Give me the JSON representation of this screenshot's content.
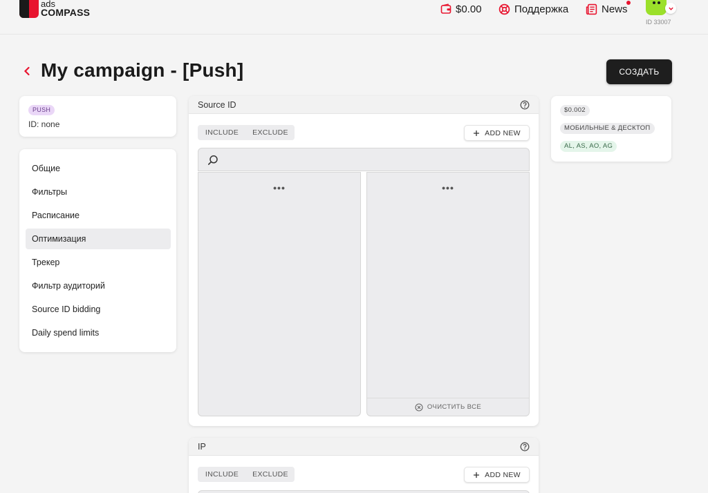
{
  "header": {
    "logo_top": "ads",
    "logo_bottom": "COMPASS",
    "balance": "$0.00",
    "support_label": "Поддержка",
    "news_label": "News",
    "user_id": "ID 33007"
  },
  "page": {
    "title": "My campaign - [Push]",
    "create_label": "СОЗДАТЬ"
  },
  "campaign": {
    "type_badge": "PUSH",
    "id_text": "ID: none"
  },
  "sidebar": {
    "items": [
      {
        "label": "Общие",
        "active": false
      },
      {
        "label": "Фильтры",
        "active": false
      },
      {
        "label": "Расписание",
        "active": false
      },
      {
        "label": "Оптимизация",
        "active": true
      },
      {
        "label": "Трекер",
        "active": false
      },
      {
        "label": "Фильтр аудиторий",
        "active": false
      },
      {
        "label": "Source ID bidding",
        "active": false
      },
      {
        "label": "Daily spend limits",
        "active": false
      }
    ]
  },
  "source_section": {
    "title": "Source ID",
    "include_label": "INCLUDE",
    "exclude_label": "EXCLUDE",
    "add_new_label": "ADD NEW",
    "search_value": "",
    "left_loading": "•••",
    "right_loading": "•••",
    "clear_all_label": "ОЧИСТИТЬ ВСЕ"
  },
  "ip_section": {
    "title": "IP",
    "include_label": "INCLUDE",
    "exclude_label": "EXCLUDE",
    "add_new_label": "ADD NEW"
  },
  "summary": {
    "price": "$0.002",
    "devices": "МОБИЛЬНЫЕ & ДЕСКТОП",
    "geo": "AL, AS, AO, AG"
  },
  "colors": {
    "brand_red": "#e8142f",
    "button_dark": "#1e1e1e",
    "push_badge_bg": "#ead7f7",
    "geo_chip_bg": "#e4f5ea"
  },
  "icons": {
    "balance": "wallet-icon",
    "support": "lifebuoy-icon",
    "news": "newspaper-icon",
    "help": "question-circle-icon",
    "search": "search-icon",
    "add": "plus-icon",
    "clear": "close-circle-icon",
    "back": "chevron-left-icon"
  }
}
